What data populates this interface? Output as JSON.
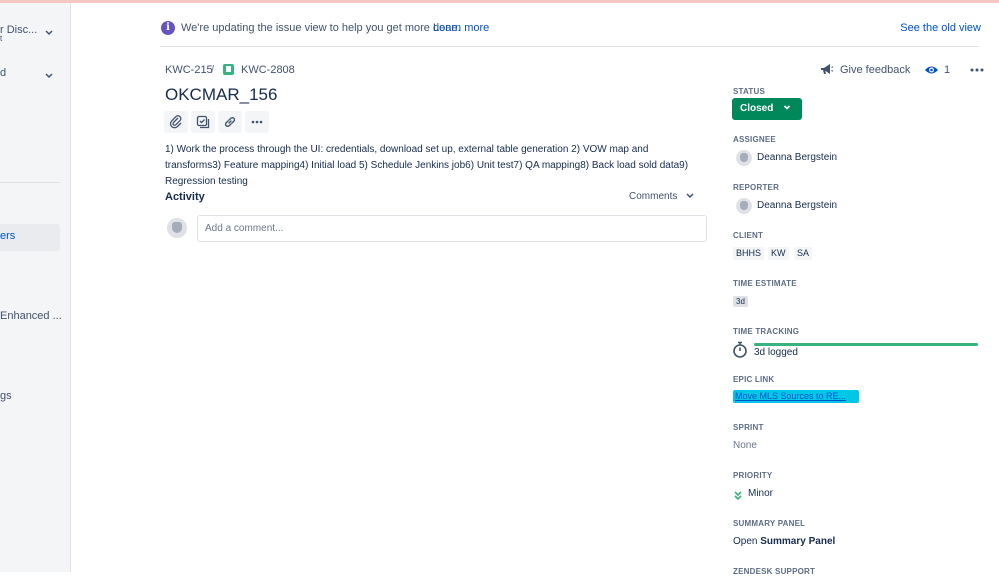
{
  "sidebar": {
    "items": [
      {
        "label": "r Disc...",
        "sub": "t"
      },
      {
        "label": "d"
      },
      {
        "label": "ers"
      },
      {
        "label": "Enhanced ..."
      },
      {
        "label": "gs"
      }
    ]
  },
  "banner": {
    "text": "We're updating the issue view to help you get more done.",
    "link": "Learn more",
    "old_view": "See the old view"
  },
  "breadcrumbs": {
    "parent": "KWC-215",
    "separator": "/",
    "issue": "KWC-2808"
  },
  "issue": {
    "title": "OKCMAR_156",
    "description": "1) Work the process through the UI: credentials, download set up, external table generation 2) VOW map and transforms3) Feature mapping4) Initial load 5) Schedule Jenkins job6) Unit test7) QA mapping8) Back load sold data9) Regression testing"
  },
  "activity": {
    "heading": "Activity",
    "filter": "Comments",
    "comment_placeholder": "Add a comment..."
  },
  "header_actions": {
    "feedback": "Give feedback",
    "watchers": "1"
  },
  "details": {
    "status": {
      "label": "STATUS",
      "value": "Closed"
    },
    "assignee": {
      "label": "ASSIGNEE",
      "value": "Deanna Bergstein"
    },
    "reporter": {
      "label": "REPORTER",
      "value": "Deanna Bergstein"
    },
    "client": {
      "label": "CLIENT",
      "tags": [
        "BHHS",
        "KW",
        "SA"
      ]
    },
    "time_estimate": {
      "label": "TIME ESTIMATE",
      "value": "3d"
    },
    "time_tracking": {
      "label": "TIME TRACKING",
      "value": "3d logged",
      "progress": 1.0
    },
    "epic_link": {
      "label": "EPIC LINK",
      "value": "Move MLS Sources to RE..."
    },
    "sprint": {
      "label": "SPRINT",
      "value": "None"
    },
    "priority": {
      "label": "PRIORITY",
      "value": "Minor"
    },
    "summary_panel": {
      "label": "SUMMARY PANEL",
      "prefix": "Open",
      "value": "Summary Panel"
    },
    "zendesk": {
      "label": "ZENDESK SUPPORT"
    }
  },
  "colors": {
    "status_closed": "#00875a",
    "link": "#0052cc",
    "epic_bg": "#00c7e6",
    "progress": "#36b37e",
    "info": "#6554c0"
  }
}
